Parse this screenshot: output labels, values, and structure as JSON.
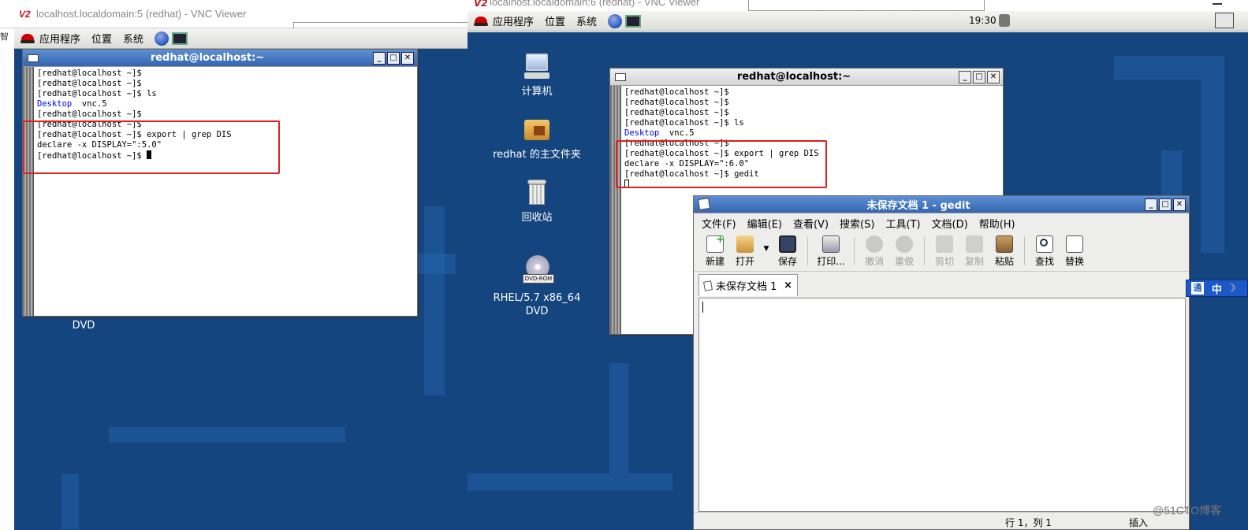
{
  "left_vnc": {
    "title": "localhost.localdomain:5 (redhat) - VNC Viewer",
    "edge_text": "智能",
    "panel": {
      "apps": "应用程序",
      "places": "位置",
      "system": "系统"
    },
    "terminal": {
      "title": "redhat@localhost:~",
      "lines": [
        "[redhat@localhost ~]$",
        "[redhat@localhost ~]$",
        "[redhat@localhost ~]$ ls",
        "",
        "[redhat@localhost ~]$",
        "[redhat@localhost ~]$",
        "[redhat@localhost ~]$ export | grep DIS",
        "declare -x DISPLAY=\":5.0\"",
        "[redhat@localhost ~]$ "
      ],
      "ls_dir": "Desktop",
      "ls_file": "vnc.5"
    },
    "dvd_fragment": "DVD"
  },
  "right_vnc": {
    "title": "localhost.localdomain:6 (redhat) - VNC Viewer",
    "panel": {
      "apps": "应用程序",
      "places": "位置",
      "system": "系统",
      "clock": "19:30"
    },
    "desktop_icons": {
      "computer": "计算机",
      "home": "redhat 的主文件夹",
      "trash": "回收站",
      "dvd_line1": "RHEL/5.7 x86_64",
      "dvd_line2": "DVD",
      "dvd_badge": "DVD-ROM"
    },
    "terminal": {
      "title": "redhat@localhost:~",
      "lines": [
        "[redhat@localhost ~]$",
        "[redhat@localhost ~]$",
        "[redhat@localhost ~]$",
        "[redhat@localhost ~]$ ls",
        "",
        "[redhat@localhost ~]$",
        "[redhat@localhost ~]$ export | grep DIS",
        "declare -x DISPLAY=\":6.0\"",
        "[redhat@localhost ~]$ gedit"
      ],
      "ls_dir": "Desktop",
      "ls_file": "vnc.5"
    },
    "gedit": {
      "title": "未保存文档 1 - gedit",
      "menu": [
        "文件(F)",
        "编辑(E)",
        "查看(V)",
        "搜索(S)",
        "工具(T)",
        "文档(D)",
        "帮助(H)"
      ],
      "toolbar": {
        "new": "新建",
        "open": "打开",
        "save": "保存",
        "print": "打印...",
        "undo": "撤消",
        "redo": "重做",
        "cut": "剪切",
        "copy": "复制",
        "paste": "粘贴",
        "find": "查找",
        "replace": "替换"
      },
      "tab_label": "未保存文档 1",
      "tab_close": "×",
      "status_pos": "行 1，列 1",
      "status_mode": "插入"
    },
    "ime": {
      "symbol": "通",
      "mode": "中",
      "moon": "☽"
    },
    "watermark": "@51CTO博客"
  },
  "colors": {
    "desktop": "#14457e",
    "highlight_box": "#e02020",
    "active_title": "#3565b0"
  }
}
